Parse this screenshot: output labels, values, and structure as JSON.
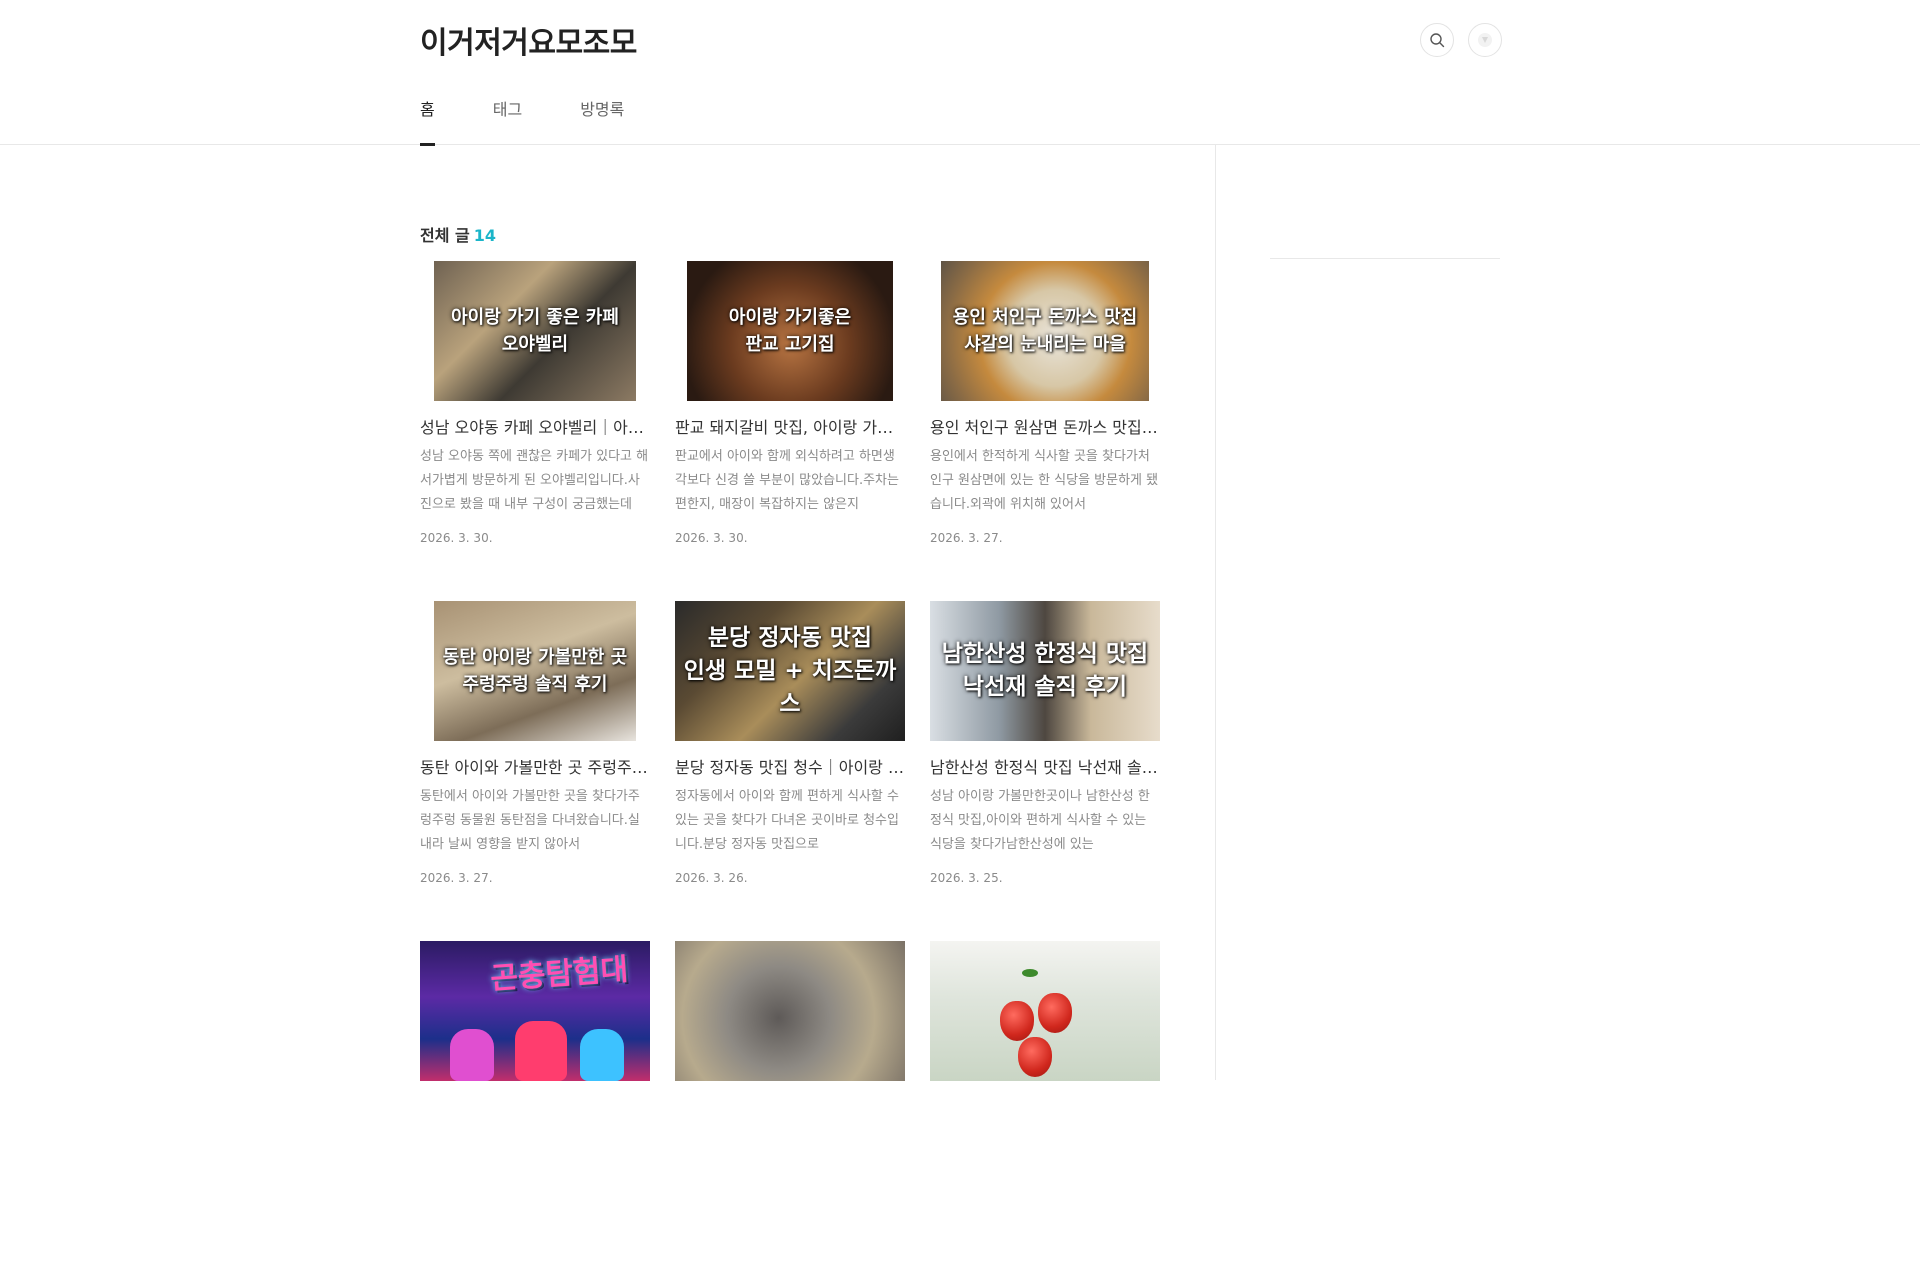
{
  "blog": {
    "title": "이거저거요모조모"
  },
  "nav": {
    "items": [
      "홈",
      "태그",
      "방명록"
    ],
    "active": "홈"
  },
  "section": {
    "label": "전체 글",
    "count": "14"
  },
  "posts": [
    {
      "title": "성남 오야동 카페 오야벨리｜아이랑 가기 좋은 카페",
      "summary": "성남 오야동 쪽에 괜찮은 카페가 있다고 해서가볍게 방문하게 된 오야벨리입니다.사진으로 봤을 때 내부 구성이 궁금했는데",
      "date": "2026. 3. 30.",
      "overlay": "아이랑 가기 좋은 카페\n오야벨리"
    },
    {
      "title": "판교 돼지갈비 맛집, 아이랑 가기좋은 판교 고기집",
      "summary": "판교에서 아이와 함께 외식하려고 하면생각보다 신경 쓸 부분이 많았습니다.주차는 편한지, 매장이 복잡하지는 않은지",
      "date": "2026. 3. 30.",
      "overlay": "아이랑 가기좋은\n판교 고기집"
    },
    {
      "title": "용인 처인구 원삼면 돈까스 맛집 샤갈의 눈내리는 마을",
      "summary": "용인에서 한적하게 식사할 곳을 찾다가처인구 원삼면에 있는 한 식당을 방문하게 됐습니다.외곽에 위치해 있어서",
      "date": "2026. 3. 27.",
      "overlay": "용인 처인구 돈까스 맛집\n샤갈의 눈내리는 마을"
    },
    {
      "title": "동탄 아이와 가볼만한 곳 주렁주렁 솔직 후기",
      "summary": "동탄에서 아이와 가볼만한 곳을 찾다가주렁주렁 동물원 동탄점을 다녀왔습니다.실내라 날씨 영향을 받지 않아서",
      "date": "2026. 3. 27.",
      "overlay": "동탄 아이랑 가볼만한 곳\n주렁주렁 솔직 후기"
    },
    {
      "title": "분당 정자동 맛집 청수｜아이랑 가기 좋은 식당",
      "summary": "정자동에서 아이와 함께 편하게 식사할 수 있는 곳을 찾다가 다녀온 곳이바로 청수입니다.분당 정자동 맛집으로",
      "date": "2026. 3. 26.",
      "overlay": "분당 정자동 맛집\n인생 모밀 + 치즈돈까스"
    },
    {
      "title": "남한산성 한정식 맛집 낙선재 솔직 후기",
      "summary": "성남 아이랑 가볼만한곳이나 남한산성 한정식 맛집,아이와 편하게 식사할 수 있는 식당을 찾다가남한산성에 있는",
      "date": "2026. 3. 25.",
      "overlay": "남한산성 한정식 맛집\n낙선재 솔직 후기"
    },
    {
      "title": "",
      "summary": "",
      "date": "",
      "overlay": ""
    },
    {
      "title": "",
      "summary": "",
      "date": "",
      "overlay": ""
    },
    {
      "title": "",
      "summary": "",
      "date": "",
      "overlay": ""
    }
  ],
  "extra": {
    "insect_sign": "곤충탐험대"
  },
  "colors": {
    "accent": "#1bb5c9",
    "text": "#222222",
    "muted": "#8a8a8a",
    "border": "#e8e8e8"
  },
  "icons": {
    "search": "search-icon",
    "profile": "profile-icon"
  }
}
